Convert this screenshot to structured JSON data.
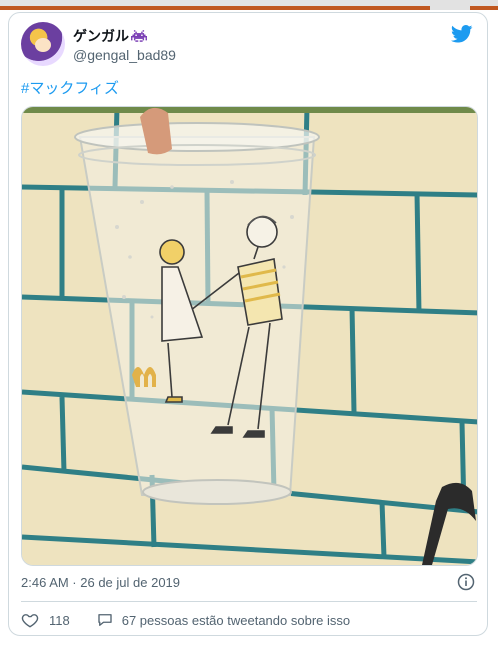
{
  "tweet": {
    "display_name": "ゲンガル",
    "handle": "@gengal_bad89",
    "hashtag": "#マックフィズ",
    "timestamp": "2:46 AM · 26 de jul de 2019",
    "likes": "118",
    "conversation": "67 pessoas estão tweetando sobre isso"
  },
  "icons": {
    "invader": "space-invader-icon",
    "logo": "twitter-bird-icon",
    "info": "info-icon",
    "like": "heart-icon",
    "reply": "speech-bubble-icon"
  },
  "colors": {
    "link": "#1d9bf0",
    "muted": "#536471",
    "border": "#cfd9de",
    "invader": "#7b3fb5",
    "topbar_accent": "#c0571f"
  }
}
